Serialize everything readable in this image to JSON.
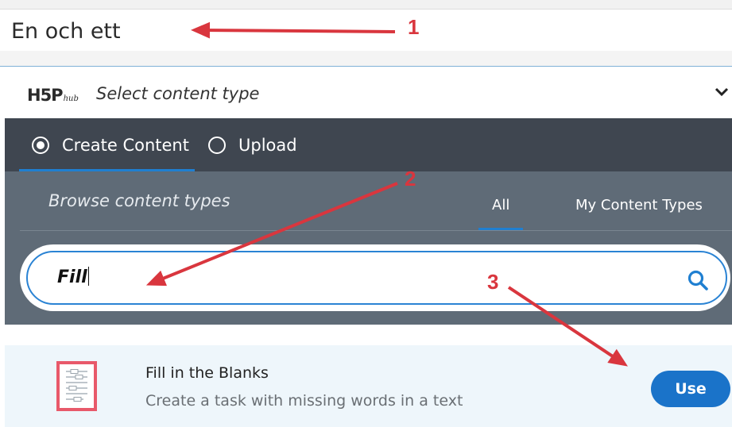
{
  "title_field": {
    "value": "En och ett"
  },
  "hub": {
    "logo_main": "H5P",
    "logo_sub": "hub",
    "select_label": "Select content type"
  },
  "tabs": [
    {
      "label": "Create Content",
      "selected": true
    },
    {
      "label": "Upload",
      "selected": false
    }
  ],
  "browse": {
    "label": "Browse content types",
    "filters": [
      {
        "label": "All",
        "active": true
      },
      {
        "label": "My Content Types",
        "active": false
      }
    ]
  },
  "search": {
    "value": "Fill"
  },
  "results": [
    {
      "title": "Fill in the Blanks",
      "description": "Create a task with missing words in a text",
      "button": "Use"
    }
  ],
  "annotations": [
    {
      "number": "1"
    },
    {
      "number": "2"
    },
    {
      "number": "3"
    }
  ],
  "colors": {
    "tabbar": "#3f4650",
    "browse_bg": "#5f6b77",
    "accent": "#1f7fd1",
    "use_button": "#1a73c9",
    "annotation": "#d9363e",
    "result_icon_border": "#e8596a"
  }
}
